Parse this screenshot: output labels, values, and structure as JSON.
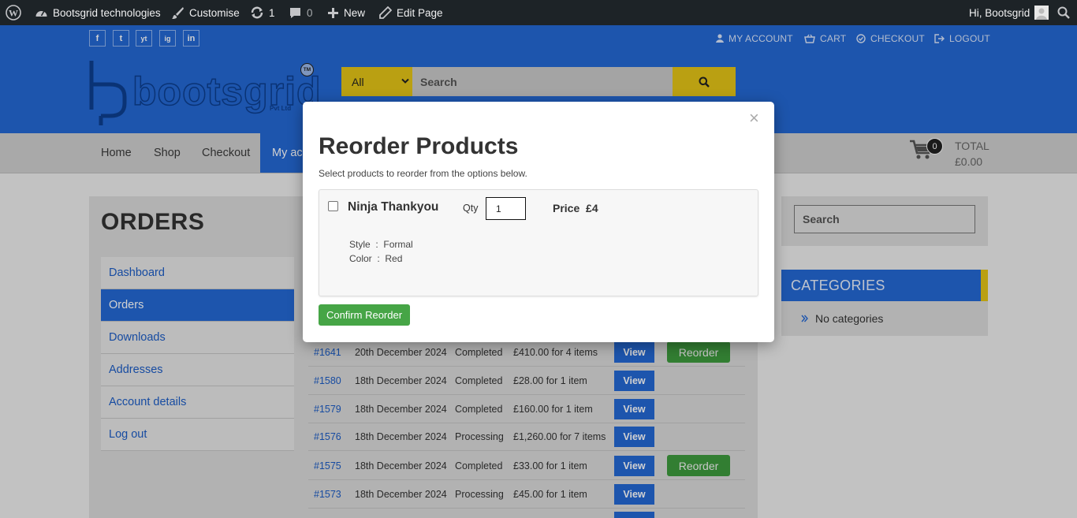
{
  "admin_bar": {
    "site_name": "Bootsgrid technologies",
    "customise": "Customise",
    "updates_count": "1",
    "comments_count": "0",
    "new_label": "New",
    "edit_page": "Edit Page",
    "greeting": "Hi, Bootsgrid"
  },
  "top_links": {
    "social": [
      "f",
      "t",
      "yt",
      "ig",
      "in"
    ],
    "my_account": "MY ACCOUNT",
    "cart": "CART",
    "checkout": "CHECKOUT",
    "logout": "LOGOUT"
  },
  "header": {
    "logo_text": "bootsgrid",
    "logo_sub": "Pvt Ltd",
    "logo_tm": "TM",
    "category_select": "All",
    "search_placeholder": "Search"
  },
  "nav": {
    "items": [
      "Home",
      "Shop",
      "Checkout",
      "My ac"
    ],
    "cart_count": "0",
    "total_label": "TOTAL",
    "total_value": "£0.00"
  },
  "page": {
    "title": "ORDERS",
    "account_nav": [
      "Dashboard",
      "Orders",
      "Downloads",
      "Addresses",
      "Account details",
      "Log out"
    ],
    "orders": [
      {
        "number": "#1641",
        "date": "20th December 2024",
        "status": "Completed",
        "total": "£410.00 for 4 items",
        "view": "View",
        "reorder": "Reorder"
      },
      {
        "number": "#1580",
        "date": "18th December 2024",
        "status": "Completed",
        "total": "£28.00 for 1 item",
        "view": "View",
        "reorder": ""
      },
      {
        "number": "#1579",
        "date": "18th December 2024",
        "status": "Completed",
        "total": "£160.00 for 1 item",
        "view": "View",
        "reorder": ""
      },
      {
        "number": "#1576",
        "date": "18th December 2024",
        "status": "Processing",
        "total": "£1,260.00 for 7 items",
        "view": "View",
        "reorder": ""
      },
      {
        "number": "#1575",
        "date": "18th December 2024",
        "status": "Completed",
        "total": "£33.00 for 1 item",
        "view": "View",
        "reorder": "Reorder"
      },
      {
        "number": "#1573",
        "date": "18th December 2024",
        "status": "Processing",
        "total": "£45.00 for 1 item",
        "view": "View",
        "reorder": ""
      }
    ]
  },
  "sidebar": {
    "search_placeholder": "Search",
    "categories_title": "CATEGORIES",
    "no_categories": "No categories"
  },
  "modal": {
    "close": "×",
    "title": "Reorder Products",
    "subtitle": "Select products to reorder from the options below.",
    "product": {
      "name": "Ninja Thankyou",
      "qty_label": "Qty",
      "qty_value": "1",
      "price_label": "Price",
      "price_value": "£4",
      "style_label": "Style",
      "style_value": "Formal",
      "color_label": "Color",
      "color_value": "Red"
    },
    "confirm_button": "Confirm Reorder"
  }
}
